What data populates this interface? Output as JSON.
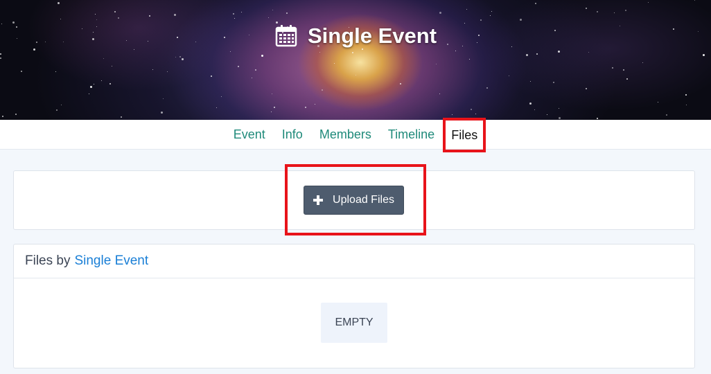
{
  "banner": {
    "icon": "calendar-icon",
    "title": "Single Event"
  },
  "tabs": [
    {
      "label": "Event",
      "active": false
    },
    {
      "label": "Info",
      "active": false
    },
    {
      "label": "Members",
      "active": false
    },
    {
      "label": "Timeline",
      "active": false
    },
    {
      "label": "Files",
      "active": true
    }
  ],
  "upload": {
    "icon": "plus-icon",
    "label": "Upload Files"
  },
  "files_panel": {
    "prefix": "Files by",
    "owner_link": "Single Event",
    "empty_text": "EMPTY"
  },
  "colors": {
    "tab_link": "#1f8a7a",
    "highlight": "#e8131a",
    "button": "#4e5c6e",
    "link": "#1a7fd6"
  }
}
